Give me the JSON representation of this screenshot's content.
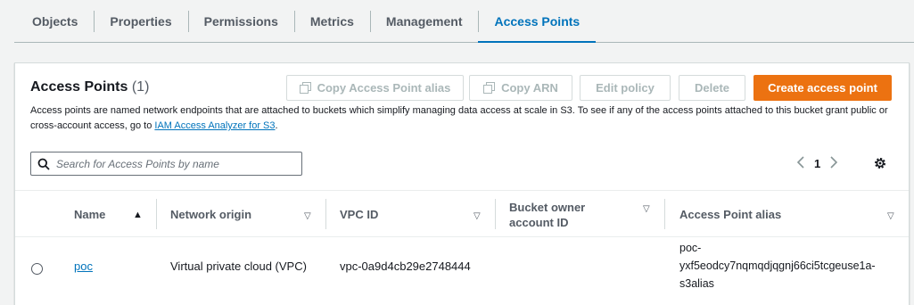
{
  "tabs": [
    "Objects",
    "Properties",
    "Permissions",
    "Metrics",
    "Management",
    "Access Points"
  ],
  "active_tab": "Access Points",
  "panel": {
    "title": "Access Points",
    "count": "(1)",
    "description": "Access points are named network endpoints that are attached to buckets which simplify managing data access at scale in S3. To see if any of the access points attached to this bucket grant public or cross-account access, go to ",
    "description_link": "IAM Access Analyzer for S3",
    "description_end": "."
  },
  "buttons": {
    "copy_alias": "Copy Access Point alias",
    "copy_arn": "Copy ARN",
    "edit_policy": "Edit policy",
    "delete": "Delete",
    "create": "Create access point"
  },
  "search": {
    "placeholder": "Search for Access Points by name"
  },
  "pagination": {
    "page": "1"
  },
  "table": {
    "columns": [
      "Name",
      "Network origin",
      "VPC ID",
      "Bucket owner account ID",
      "Access Point alias"
    ],
    "rows": [
      {
        "name": "poc",
        "network_origin": "Virtual private cloud (VPC)",
        "vpc_id": "vpc-0a9d4cb29e2748444",
        "bucket_owner": "",
        "alias_lines": [
          "poc-",
          "yxf5eodcy7nqmqdjqgnj66ci5tcgeuse1a-",
          "s3alias"
        ]
      }
    ]
  },
  "icons": [
    "copy-icon",
    "search-icon",
    "chevron-left-icon",
    "chevron-right-icon",
    "gear-icon",
    "sort-ascending-icon",
    "sort-caret-icon"
  ],
  "colors": {
    "accent": "#0073bb",
    "primary_button": "#ec7211",
    "disabled_text": "#aab7b8"
  }
}
